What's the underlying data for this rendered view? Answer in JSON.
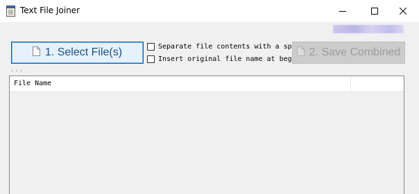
{
  "window": {
    "title": "Text File Joiner",
    "controls": [
      "minimize-icon",
      "maximize-icon",
      "close-icon"
    ]
  },
  "toolbar": {
    "select_label": "1. Select File(s)",
    "save_label": "2. Save Combined",
    "save_enabled": false,
    "options": [
      {
        "label": "Separate file contents with a space",
        "checked": false
      },
      {
        "label": "Insert original file name at beginning",
        "checked": false
      }
    ],
    "separator_text": "..."
  },
  "list": {
    "columns": [
      "File Name",
      ""
    ],
    "rows": []
  },
  "colors": {
    "accent_border": "#0a5fb4",
    "accent_bg": "#e5f1fb",
    "disabled_bg": "#cccccc",
    "window_bg": "#f0f0f0"
  }
}
